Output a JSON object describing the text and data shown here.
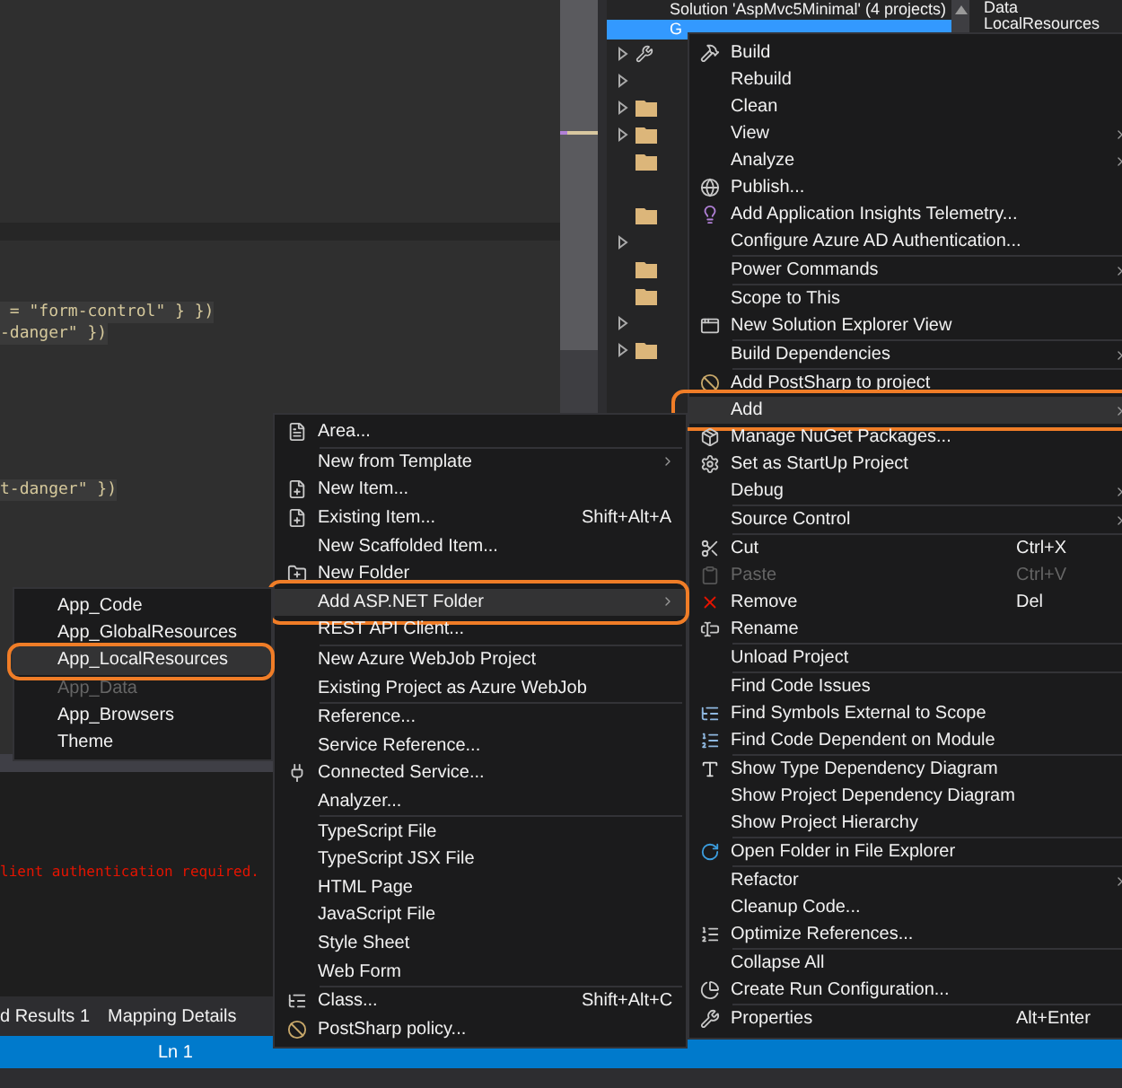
{
  "editor": {
    "code_lines": [
      {
        "text": " = \"form-control\" } })"
      },
      {
        "text": "-danger\" })"
      },
      {
        "text": "t-danger\" })"
      }
    ]
  },
  "solution_explorer": {
    "rows": [
      {
        "label": "Solution 'AspMvc5Minimal' (4 projects)",
        "selected": false
      },
      {
        "label": "G",
        "selected": true
      }
    ],
    "side_texts": [
      "Data",
      "LocalResources"
    ]
  },
  "output": {
    "error_text": "lient authentication required."
  },
  "bottom_tabs": [
    {
      "label": "d Results 1"
    },
    {
      "label": "Mapping Details"
    }
  ],
  "status_bar": {
    "line": "Ln 1"
  },
  "context_menu": {
    "items": [
      {
        "kind": "item",
        "label": "Build",
        "selected": false,
        "disabled": false
      },
      {
        "kind": "item",
        "label": "Rebuild",
        "selected": false,
        "disabled": false
      },
      {
        "kind": "item",
        "label": "Clean",
        "selected": false,
        "disabled": false
      },
      {
        "kind": "item",
        "label": "View",
        "submenu": true,
        "selected": false,
        "disabled": false
      },
      {
        "kind": "item",
        "label": "Analyze",
        "submenu": true,
        "selected": false,
        "disabled": false
      },
      {
        "kind": "item",
        "label": "Publish...",
        "selected": false,
        "disabled": false
      },
      {
        "kind": "item",
        "label": "Add Application Insights Telemetry...",
        "selected": false,
        "disabled": false
      },
      {
        "kind": "item",
        "label": "Configure Azure AD Authentication...",
        "selected": false,
        "disabled": false
      },
      {
        "kind": "separator"
      },
      {
        "kind": "item",
        "label": "Power Commands",
        "submenu": true,
        "selected": false,
        "disabled": false
      },
      {
        "kind": "separator"
      },
      {
        "kind": "item",
        "label": "Scope to This",
        "selected": false,
        "disabled": false
      },
      {
        "kind": "item",
        "label": "New Solution Explorer View",
        "selected": false,
        "disabled": false
      },
      {
        "kind": "separator"
      },
      {
        "kind": "item",
        "label": "Build Dependencies",
        "submenu": true,
        "selected": false,
        "disabled": false
      },
      {
        "kind": "separator"
      },
      {
        "kind": "item",
        "label": "Add PostSharp to project",
        "selected": false,
        "disabled": false
      },
      {
        "kind": "item",
        "label": "Add",
        "submenu": true,
        "selected": true,
        "disabled": false,
        "annotated": true
      },
      {
        "kind": "item",
        "label": "Manage NuGet Packages...",
        "selected": false,
        "disabled": false
      },
      {
        "kind": "item",
        "label": "Set as StartUp Project",
        "selected": false,
        "disabled": false
      },
      {
        "kind": "item",
        "label": "Debug",
        "submenu": true,
        "selected": false,
        "disabled": false
      },
      {
        "kind": "separator"
      },
      {
        "kind": "item",
        "label": "Source Control",
        "submenu": true,
        "selected": false,
        "disabled": false
      },
      {
        "kind": "separator"
      },
      {
        "kind": "item",
        "label": "Cut",
        "shortcut": "Ctrl+X",
        "selected": false,
        "disabled": false
      },
      {
        "kind": "item",
        "label": "Paste",
        "shortcut": "Ctrl+V",
        "selected": false,
        "disabled": true
      },
      {
        "kind": "item",
        "label": "Remove",
        "shortcut": "Del",
        "selected": false,
        "disabled": false
      },
      {
        "kind": "item",
        "label": "Rename",
        "selected": false,
        "disabled": false
      },
      {
        "kind": "separator"
      },
      {
        "kind": "item",
        "label": "Unload Project",
        "selected": false,
        "disabled": false
      },
      {
        "kind": "separator"
      },
      {
        "kind": "item",
        "label": "Find Code Issues",
        "selected": false,
        "disabled": false
      },
      {
        "kind": "item",
        "label": "Find Symbols External to Scope",
        "selected": false,
        "disabled": false
      },
      {
        "kind": "item",
        "label": "Find Code Dependent on Module",
        "selected": false,
        "disabled": false
      },
      {
        "kind": "separator"
      },
      {
        "kind": "item",
        "label": "Show Type Dependency Diagram",
        "selected": false,
        "disabled": false
      },
      {
        "kind": "item",
        "label": "Show Project Dependency Diagram",
        "selected": false,
        "disabled": false
      },
      {
        "kind": "item",
        "label": "Show Project Hierarchy",
        "selected": false,
        "disabled": false
      },
      {
        "kind": "separator"
      },
      {
        "kind": "item",
        "label": "Open Folder in File Explorer",
        "selected": false,
        "disabled": false
      },
      {
        "kind": "separator"
      },
      {
        "kind": "item",
        "label": "Refactor",
        "submenu": true,
        "selected": false,
        "disabled": false
      },
      {
        "kind": "item",
        "label": "Cleanup Code...",
        "selected": false,
        "disabled": false
      },
      {
        "kind": "item",
        "label": "Optimize References...",
        "selected": false,
        "disabled": false
      },
      {
        "kind": "separator"
      },
      {
        "kind": "item",
        "label": "Collapse All",
        "selected": false,
        "disabled": false
      },
      {
        "kind": "item",
        "label": "Create Run Configuration...",
        "selected": false,
        "disabled": false
      },
      {
        "kind": "separator"
      },
      {
        "kind": "item",
        "label": "Properties",
        "shortcut": "Alt+Enter",
        "selected": false,
        "disabled": false
      }
    ]
  },
  "add_submenu": {
    "items": [
      {
        "kind": "item",
        "label": "Area...",
        "selected": false,
        "disabled": false
      },
      {
        "kind": "separator"
      },
      {
        "kind": "item",
        "label": "New from Template",
        "submenu": true,
        "selected": false,
        "disabled": false
      },
      {
        "kind": "item",
        "label": "New Item...",
        "selected": false,
        "disabled": false
      },
      {
        "kind": "item",
        "label": "Existing Item...",
        "shortcut": "Shift+Alt+A",
        "selected": false,
        "disabled": false
      },
      {
        "kind": "item",
        "label": "New Scaffolded Item...",
        "selected": false,
        "disabled": false
      },
      {
        "kind": "item",
        "label": "New Folder",
        "selected": false,
        "disabled": false
      },
      {
        "kind": "item",
        "label": "Add ASP.NET Folder",
        "submenu": true,
        "selected": true,
        "disabled": false,
        "annotated": true
      },
      {
        "kind": "item",
        "label": "REST API Client...",
        "selected": false,
        "disabled": false
      },
      {
        "kind": "separator"
      },
      {
        "kind": "item",
        "label": "New Azure WebJob Project",
        "selected": false,
        "disabled": false
      },
      {
        "kind": "item",
        "label": "Existing Project as Azure WebJob",
        "selected": false,
        "disabled": false
      },
      {
        "kind": "separator"
      },
      {
        "kind": "item",
        "label": "Reference...",
        "selected": false,
        "disabled": false
      },
      {
        "kind": "item",
        "label": "Service Reference...",
        "selected": false,
        "disabled": false
      },
      {
        "kind": "item",
        "label": "Connected Service...",
        "selected": false,
        "disabled": false
      },
      {
        "kind": "item",
        "label": "Analyzer...",
        "selected": false,
        "disabled": false
      },
      {
        "kind": "separator"
      },
      {
        "kind": "item",
        "label": "TypeScript File",
        "selected": false,
        "disabled": false
      },
      {
        "kind": "item",
        "label": "TypeScript JSX File",
        "selected": false,
        "disabled": false
      },
      {
        "kind": "item",
        "label": "HTML Page",
        "selected": false,
        "disabled": false
      },
      {
        "kind": "item",
        "label": "JavaScript File",
        "selected": false,
        "disabled": false
      },
      {
        "kind": "item",
        "label": "Style Sheet",
        "selected": false,
        "disabled": false
      },
      {
        "kind": "item",
        "label": "Web Form",
        "selected": false,
        "disabled": false
      },
      {
        "kind": "separator"
      },
      {
        "kind": "item",
        "label": "Class...",
        "shortcut": "Shift+Alt+C",
        "selected": false,
        "disabled": false
      },
      {
        "kind": "item",
        "label": "PostSharp policy...",
        "selected": false,
        "disabled": false
      }
    ]
  },
  "folder_submenu": {
    "items": [
      {
        "kind": "item",
        "label": "App_Code",
        "selected": false,
        "disabled": false
      },
      {
        "kind": "item",
        "label": "App_GlobalResources",
        "selected": false,
        "disabled": false
      },
      {
        "kind": "item",
        "label": "App_LocalResources",
        "selected": true,
        "disabled": false,
        "annotated": true
      },
      {
        "kind": "item",
        "label": "App_Data",
        "selected": false,
        "disabled": true
      },
      {
        "kind": "item",
        "label": "App_Browsers",
        "selected": false,
        "disabled": false
      },
      {
        "kind": "item",
        "label": "Theme",
        "selected": false,
        "disabled": false
      }
    ]
  }
}
